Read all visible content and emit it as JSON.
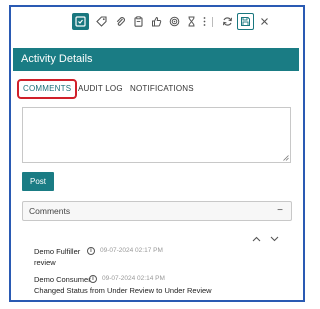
{
  "panel": {
    "title": "Activity Details",
    "accent_color": "#1a7c84",
    "focus_outline_color": "#2a5ab3"
  },
  "toolbar": {
    "icons": [
      "activity-icon",
      "tag-icon",
      "attachment-icon",
      "clipboard-icon",
      "thumbs-up-icon",
      "target-icon",
      "hourglass-icon",
      "more-icon",
      "refresh-icon",
      "save-icon",
      "close-icon"
    ]
  },
  "tabs": [
    {
      "label": "COMMENTS",
      "active": true
    },
    {
      "label": "AUDIT LOG",
      "active": false
    },
    {
      "label": "NOTIFICATIONS",
      "active": false
    }
  ],
  "comment_box": {
    "value": "",
    "placeholder": ""
  },
  "post_button": {
    "label": "Post"
  },
  "comments_section": {
    "title": "Comments",
    "toggle": "−"
  },
  "comments": [
    {
      "author": "Demo Fulfiller",
      "timestamp": "09-07-2024 02:17 PM",
      "text": "review"
    },
    {
      "author": "Demo Consumer",
      "timestamp": "09-07-2024 02:14 PM",
      "text": "Changed Status from Under Review to Under Review"
    }
  ]
}
